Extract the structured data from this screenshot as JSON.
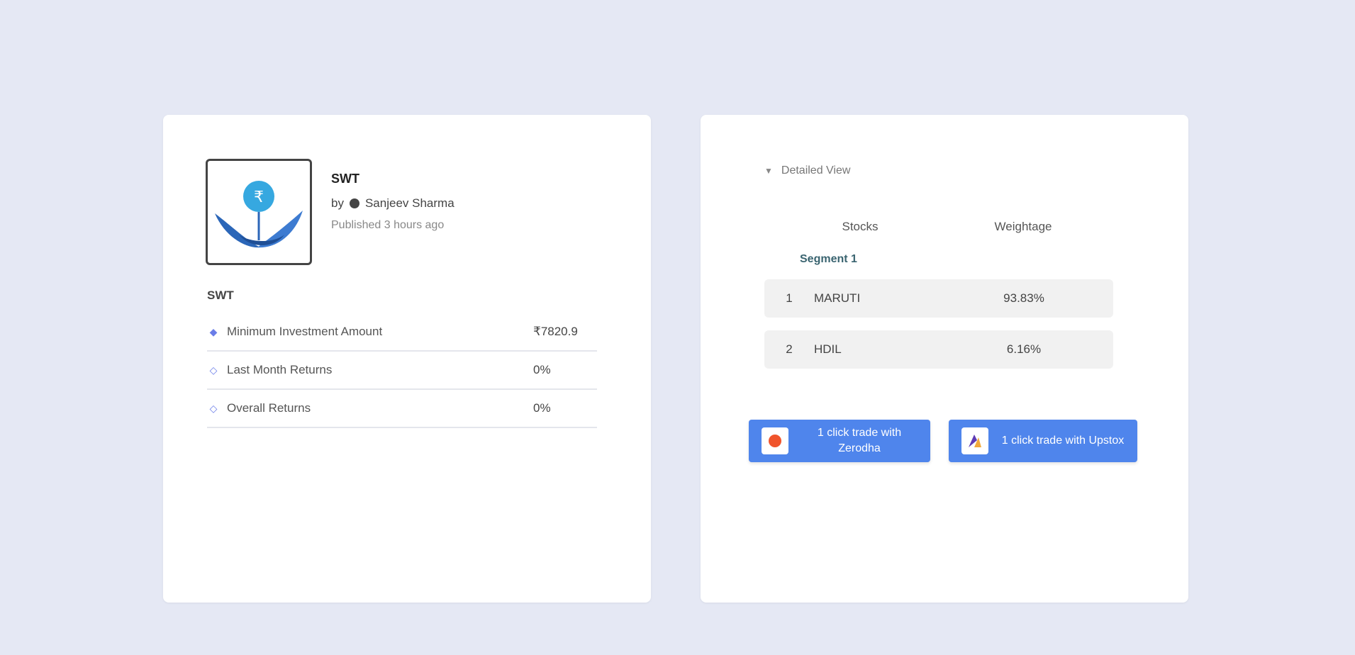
{
  "plan": {
    "title": "SWT",
    "author_prefix": "by",
    "author": "Sanjeev Sharma",
    "published": "Published 3 hours ago",
    "subtitle": "SWT"
  },
  "stats": [
    {
      "icon": "info-icon",
      "label": "Minimum Investment Amount",
      "value": "₹7820.9"
    },
    {
      "icon": "trend-icon",
      "label": "Last Month Returns",
      "value": "0%"
    },
    {
      "icon": "trend-icon",
      "label": "Overall Returns",
      "value": "0%"
    }
  ],
  "detail": {
    "toggle_label": "Detailed View",
    "columns": {
      "stocks": "Stocks",
      "weightage": "Weightage"
    },
    "segment": "Segment 1",
    "rows": [
      {
        "index": "1",
        "symbol": "MARUTI",
        "weight": "93.83%"
      },
      {
        "index": "2",
        "symbol": "HDIL",
        "weight": "6.16%"
      }
    ]
  },
  "buttons": {
    "zerodha": "1 click trade with Zerodha",
    "upstox": "1 click trade with Upstox"
  },
  "colors": {
    "background": "#e5e8f4",
    "button": "#4f85ec",
    "logo_primary": "#2b66b8",
    "logo_accent": "#36a8e0"
  }
}
